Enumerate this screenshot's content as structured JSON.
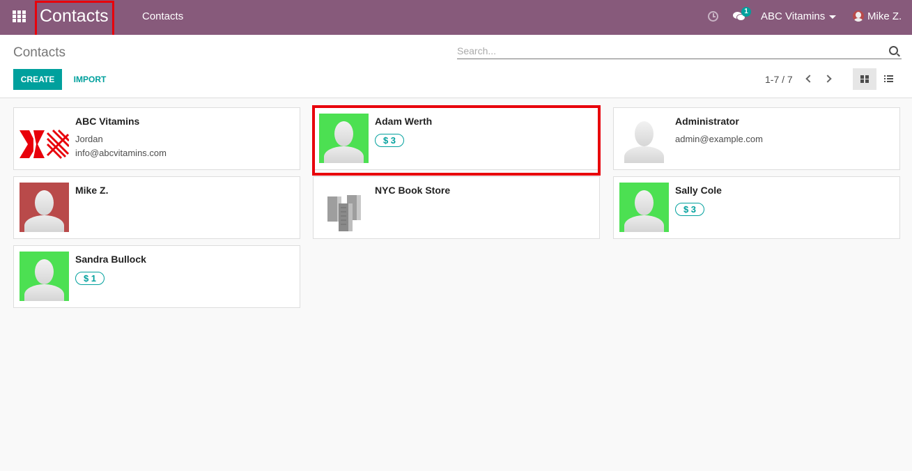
{
  "navbar": {
    "brand": "Contacts",
    "menu_item": "Contacts",
    "chat_count": "1",
    "company": "ABC Vitamins",
    "user": "Mike Z."
  },
  "control_panel": {
    "breadcrumb": "Contacts",
    "search_placeholder": "Search...",
    "create_label": "CREATE",
    "import_label": "IMPORT",
    "pager": "1-7 / 7"
  },
  "colors": {
    "navbar": "#875a7b",
    "accent": "#00a09d",
    "highlight": "#e8000b",
    "avatar_green": "#4ce052",
    "avatar_red": "#b94a4a"
  },
  "cards": [
    {
      "name": "ABC Vitamins",
      "line1": "Jordan",
      "line2": "info@abcvitamins.com",
      "image": "company-logo"
    },
    {
      "name": "Adam Werth",
      "badge": "$ 3",
      "image": "avatar-green"
    },
    {
      "name": "Administrator",
      "line1": "admin@example.com",
      "image": "avatar-white"
    },
    {
      "name": "Mike Z.",
      "image": "avatar-red"
    },
    {
      "name": "NYC Book Store",
      "image": "building-icon"
    },
    {
      "name": "Sally Cole",
      "badge": "$ 3",
      "image": "avatar-green"
    },
    {
      "name": "Sandra Bullock",
      "badge": "$ 1",
      "image": "avatar-green"
    }
  ]
}
